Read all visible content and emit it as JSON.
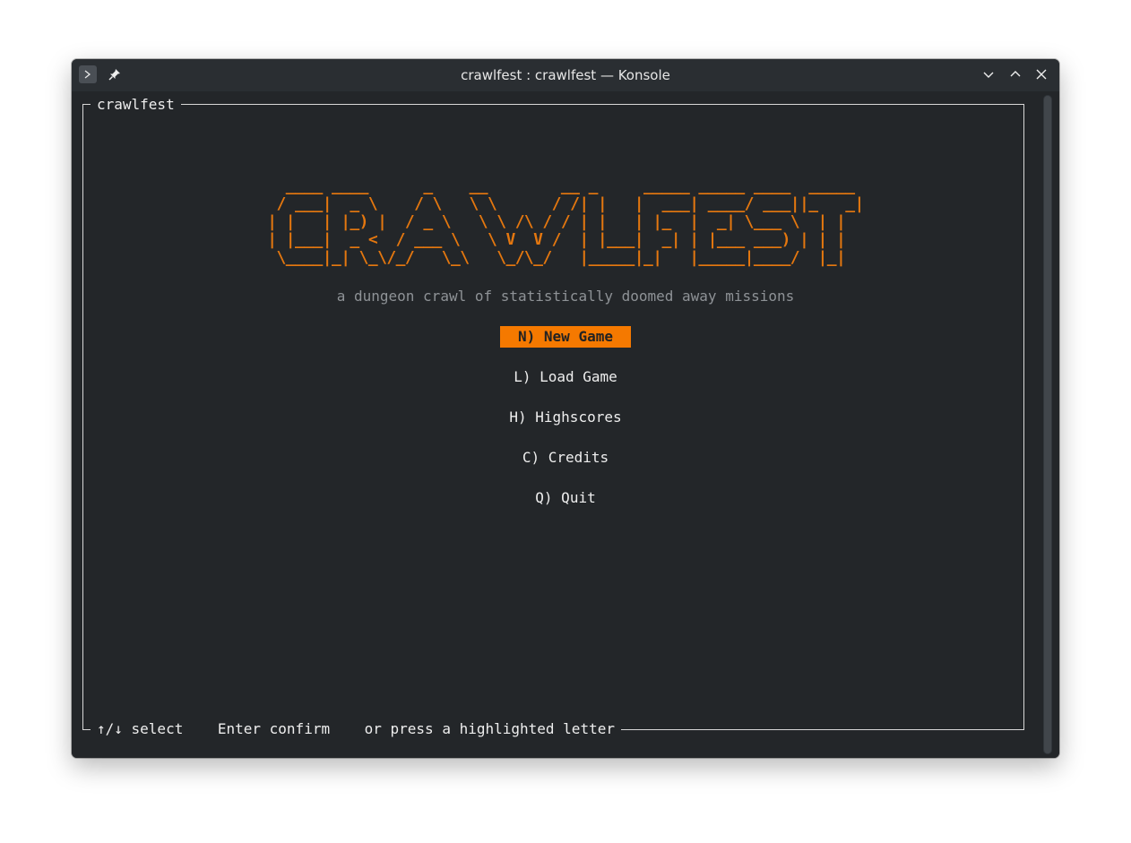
{
  "window": {
    "title": "crawlfest : crawlfest — Konsole"
  },
  "icons": {
    "terminal": "terminal-icon",
    "pin": "pin-icon",
    "minimize": "chevron-down-icon",
    "maximize": "chevron-up-icon",
    "close": "close-icon"
  },
  "colors": {
    "accent": "#f57900",
    "logo": "#e4770f",
    "background": "#232629",
    "text": "#eeeeee",
    "muted": "#8e9296"
  },
  "frame": {
    "title": "crawlfest",
    "footer": "↑/↓ select    Enter confirm    or press a highlighted letter"
  },
  "logo": {
    "text": "CRAWLFEST",
    "ascii": "  ____ ____      _    __        __ _     _____ _____ ____  _____ \n / ___|  _ \\    / \\   \\ \\      / /| |   |  ___| ____/ ___||_   _|\n| |   | |_) |  / _ \\   \\ \\ /\\ / / | |   | |_  |  _| \\___ \\  | |  \n| |___|  _ <  / ___ \\   \\ V  V /  | |___|  _| | |___ ___) | | |  \n \\____|_| \\_\\/_/   \\_\\   \\_/\\_/   |_____|_|   |_____|____/  |_|  "
  },
  "tagline": "a dungeon crawl of statistically doomed away missions",
  "menu": {
    "selected_index": 0,
    "items": [
      {
        "label": "N) New Game"
      },
      {
        "label": "L) Load Game"
      },
      {
        "label": "H) Highscores"
      },
      {
        "label": "C) Credits"
      },
      {
        "label": "Q) Quit"
      }
    ]
  }
}
